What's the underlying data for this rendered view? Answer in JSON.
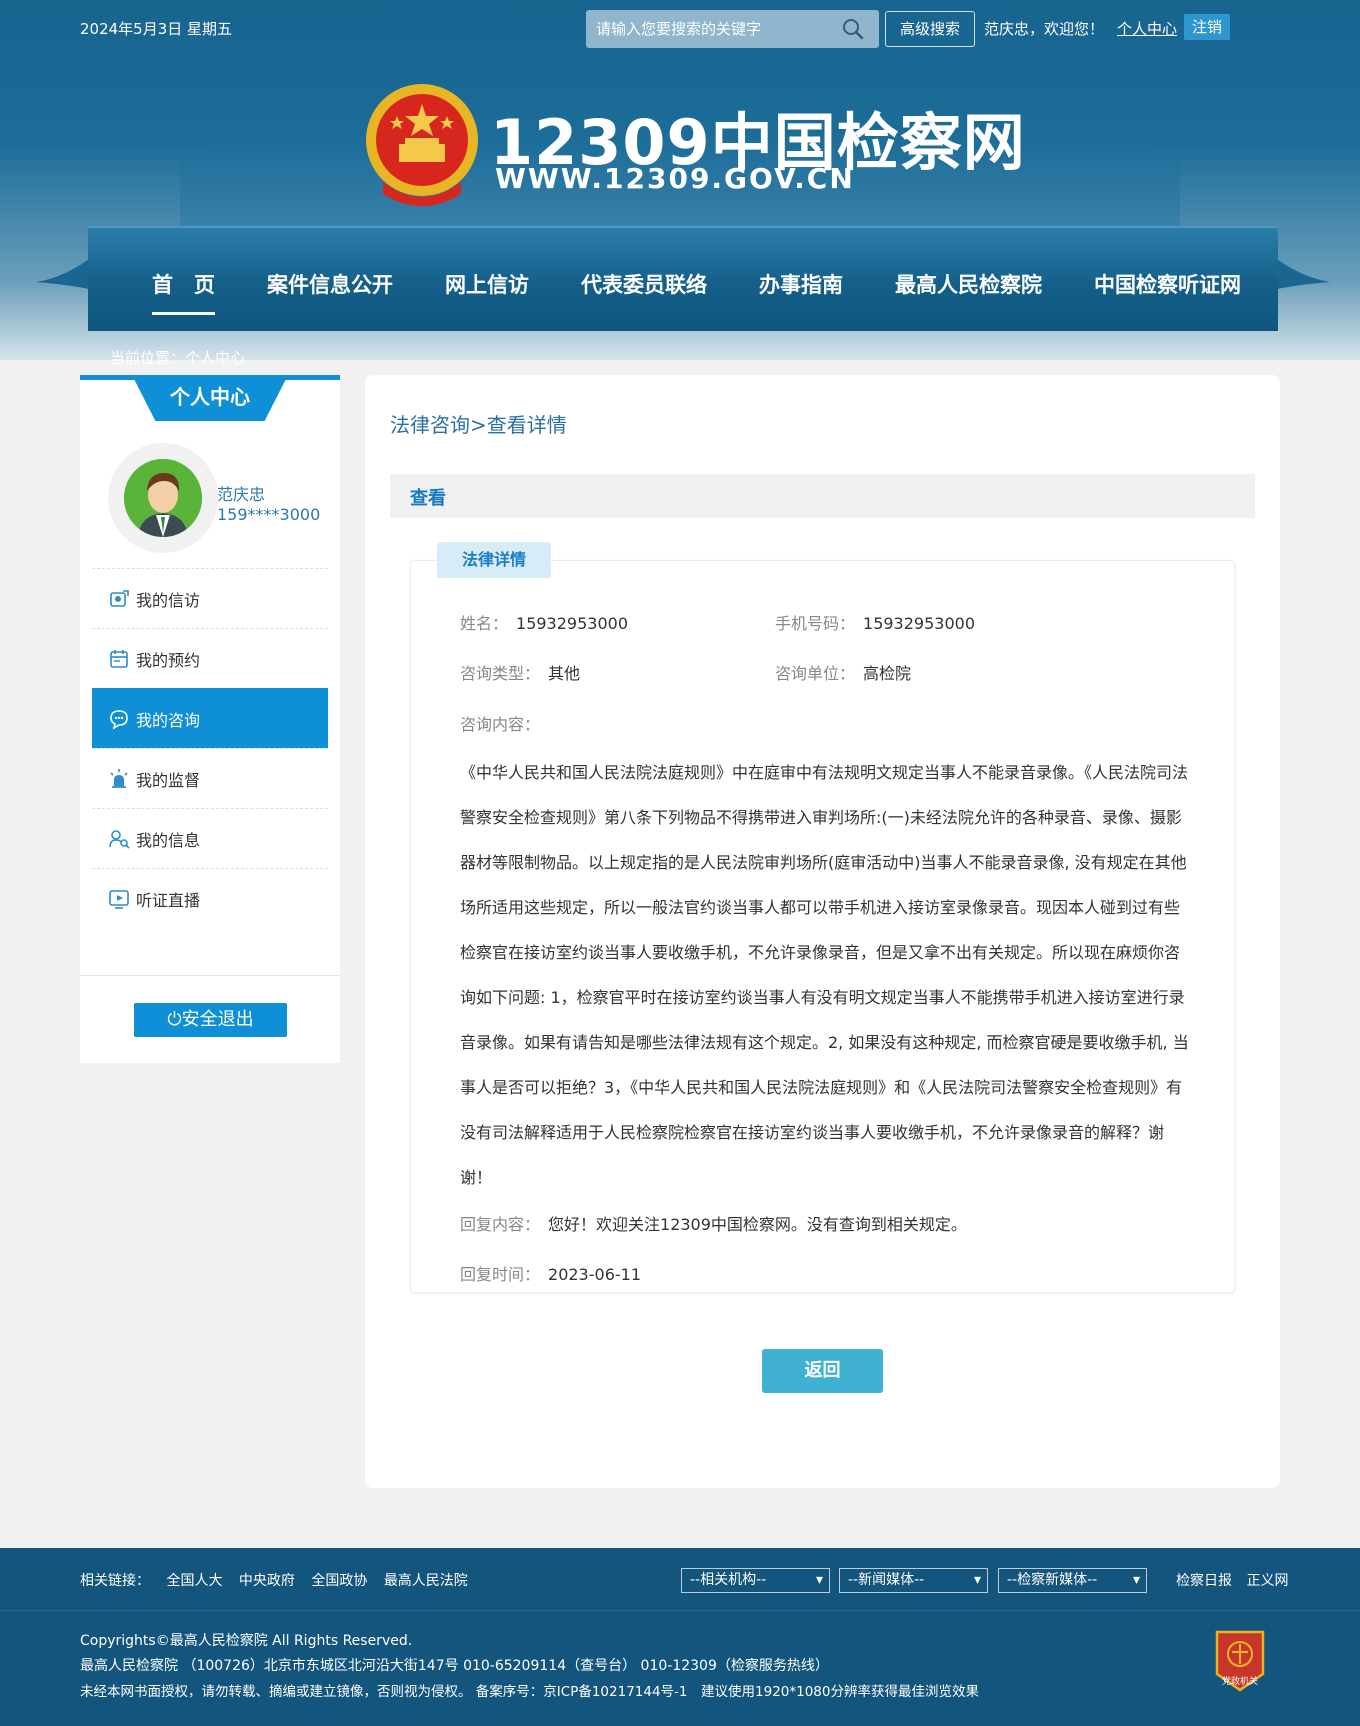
{
  "header": {
    "date": "2024年5月3日 星期五",
    "search_placeholder": "请输入您要搜索的关键字",
    "adv_search": "高级搜索",
    "welcome": "范庆忠，欢迎您！",
    "personal_center": "个人中心",
    "logout": "注销",
    "site_title": "12309中国检察网",
    "site_url": "WWW.12309.GOV.CN"
  },
  "nav": {
    "items": [
      "首　页",
      "案件信息公开",
      "网上信访",
      "代表委员联络",
      "办事指南",
      "最高人民检察院",
      "中国检察听证网"
    ]
  },
  "breadcrumb": "当前位置：个人中心",
  "sidebar": {
    "title": "个人中心",
    "name": "范庆忠",
    "phone": "159****3000",
    "menu": [
      {
        "label": "我的信访",
        "icon": "petition-icon"
      },
      {
        "label": "我的预约",
        "icon": "calendar-icon"
      },
      {
        "label": "我的咨询",
        "icon": "chat-icon"
      },
      {
        "label": "我的监督",
        "icon": "alarm-icon"
      },
      {
        "label": "我的信息",
        "icon": "user-info-icon"
      },
      {
        "label": "听证直播",
        "icon": "play-icon"
      }
    ],
    "logout": "安全退出"
  },
  "main": {
    "crumb": "法律咨询>查看详情",
    "view_label": "查看",
    "tab": "法律详情",
    "name_label": "姓名：",
    "name_value": "15932953000",
    "phone_label": "手机号码：",
    "phone_value": "15932953000",
    "type_label": "咨询类型：",
    "type_value": "其他",
    "unit_label": "咨询单位：",
    "unit_value": "高检院",
    "content_label": "咨询内容：",
    "content": "《中华人民共和国人民法院法庭规则》中在庭审中有法规明文规定当事人不能录音录像。《人民法院司法警察安全检查规则》第八条下列物品不得携带进入审判场所:(一)未经法院允许的各种录音、录像、摄影器材等限制物品。以上规定指的是人民法院审判场所(庭审活动中)当事人不能录音录像, 没有规定在其他场所适用这些规定，所以一般法官约谈当事人都可以带手机进入接访室录像录音。现因本人碰到过有些检察官在接访室约谈当事人要收缴手机，不允许录像录音，但是又拿不出有关规定。所以现在麻烦你咨询如下问题: 1，检察官平时在接访室约谈当事人有没有明文规定当事人不能携带手机进入接访室进行录音录像。如果有请告知是哪些法律法规有这个规定。2, 如果没有这种规定, 而检察官硬是要收缴手机, 当事人是否可以拒绝？3，《中华人民共和国人民法院法庭规则》和《人民法院司法警察安全检查规则》有没有司法解释适用于人民检察院检察官在接访室约谈当事人要收缴手机，不允许录像录音的解释？谢谢！",
    "reply_label": "回复内容：",
    "reply_value": "您好！欢迎关注12309中国检察网。没有查询到相关规定。",
    "reply_time_label": "回复时间：",
    "reply_time_value": "2023-06-11",
    "back": "返回"
  },
  "footer": {
    "links_label": "相关链接：",
    "links": [
      "全国人大",
      "中央政府",
      "全国政协",
      "最高人民法院"
    ],
    "selects": [
      "--相关机构--",
      "--新闻媒体--",
      "--检察新媒体--"
    ],
    "right_links": [
      "检察日报",
      "正义网"
    ],
    "copyright": "Copyrights©最高人民检察院 All Rights Reserved.",
    "address": "最高人民检察院 （100726）北京市东城区北河沿大街147号 010-65209114（查号台） 010-12309（检察服务热线）",
    "notice": "未经本网书面授权，请勿转载、摘编或建立镜像，否则视为侵权。 备案序号：京ICP备10217144号-1　建议使用1920*1080分辨率获得最佳浏览效果",
    "badge_text": "党政机关"
  }
}
